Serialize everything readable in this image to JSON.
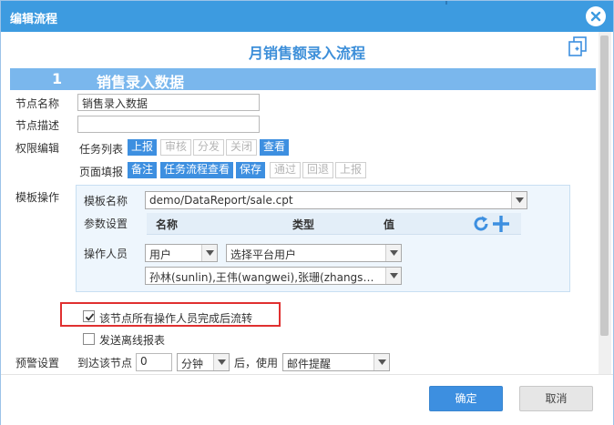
{
  "window": {
    "title": "编辑流程"
  },
  "heading": "月销售额录入流程",
  "section": {
    "number": "1",
    "label": "销售录入数据"
  },
  "fields": {
    "node_name_label": "节点名称",
    "node_name_value": "销售录入数据",
    "node_desc_label": "节点描述",
    "node_desc_value": "",
    "perm_label": "权限编辑",
    "task_list_label": "任务列表",
    "task_list_tags": [
      {
        "label": "上报",
        "active": true
      },
      {
        "label": "审核",
        "active": false
      },
      {
        "label": "分发",
        "active": false
      },
      {
        "label": "关闭",
        "active": false
      },
      {
        "label": "查看",
        "active": true
      }
    ],
    "page_fill_label": "页面填报",
    "page_fill_tags": [
      {
        "label": "备注",
        "active": true
      },
      {
        "label": "任务流程查看",
        "active": true
      },
      {
        "label": "保存",
        "active": true
      },
      {
        "label": "通过",
        "active": false
      },
      {
        "label": "回退",
        "active": false
      },
      {
        "label": "上报",
        "active": false
      }
    ]
  },
  "template": {
    "section_label": "模板操作",
    "name_label": "模板名称",
    "name_value": "demo/DataReport/sale.cpt",
    "param_label": "参数设置",
    "param_columns": [
      "名称",
      "类型",
      "值"
    ],
    "operator_label": "操作人员",
    "operator_type": "用户",
    "operator_select": "选择平台用户",
    "operator_users": "孙林(sunlin),王伟(wangwei),张珊(zhangshan..."
  },
  "options": {
    "all_operators_label": "该节点所有操作人员完成后流转",
    "all_operators_checked": true,
    "offline_report_label": "发送离线报表",
    "offline_report_checked": false
  },
  "warning": {
    "label": "预警设置",
    "prefix": "到达该节点",
    "amount": "0",
    "unit": "分钟",
    "middle": "后，使用",
    "method": "邮件提醒"
  },
  "buttons": {
    "confirm": "确定",
    "cancel": "取消"
  },
  "colors": {
    "titlebar": "#3d9be0",
    "accent": "#3d8fe0",
    "section": "#7ab7ed",
    "highlight_border": "#e03030"
  }
}
